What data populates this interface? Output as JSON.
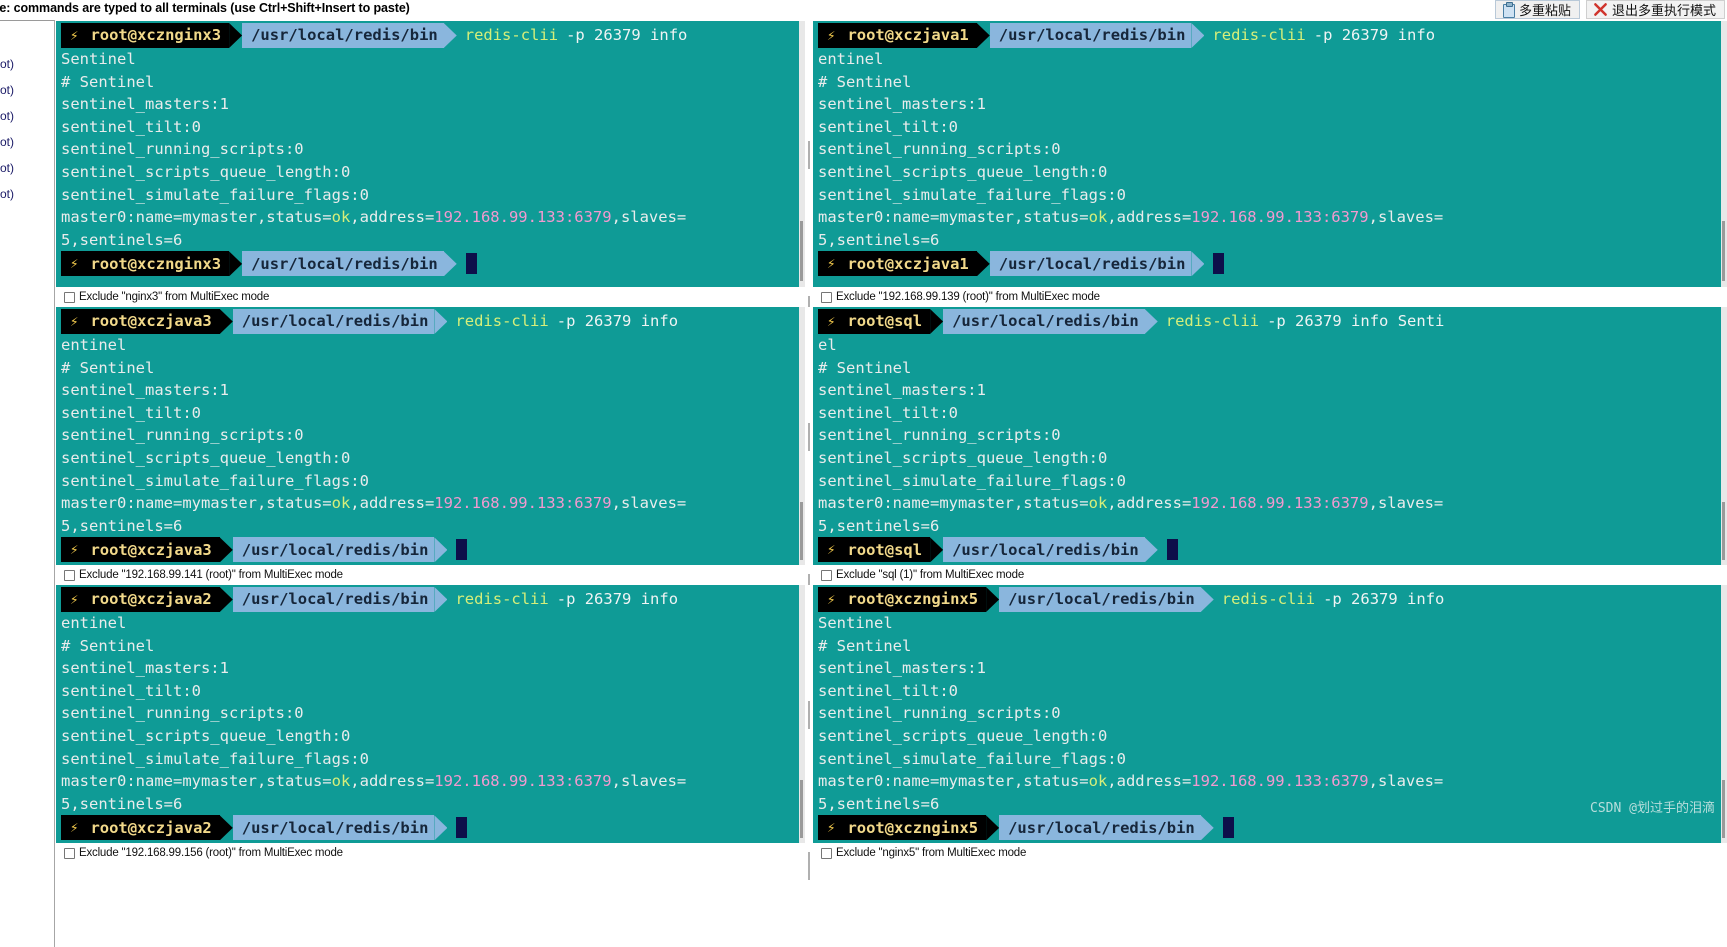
{
  "topbar": {
    "note": "le: commands are typed to all terminals (use Ctrl+Shift+Insert to paste)",
    "multi_paste_label": "多重粘贴",
    "exit_multiexec_label": "退出多重执行模式",
    "clipboard_icon": "clipboard-icon",
    "close_icon": "red-x-icon"
  },
  "sidebar": {
    "items": [
      {
        "label": "ot)"
      },
      {
        "label": "ot)"
      },
      {
        "label": "ot)"
      },
      {
        "label": "ot)"
      },
      {
        "label": "ot)"
      },
      {
        "label": "ot)"
      }
    ]
  },
  "colors": {
    "terminal_bg": "#0f9b96",
    "prompt_host_bg": "#000000",
    "prompt_host_fg": "#f2d98a",
    "prompt_path_bg": "#8ab6dd",
    "prompt_path_fg": "#16263a",
    "command_fg": "#d6ef7a",
    "address_fg": "#f39ad0",
    "cursor": "#0d0f4a",
    "accent_blue": "#4a7fa5",
    "accent_red": "#d0342c"
  },
  "prompt": {
    "bolt_glyph": "⚡",
    "path": "/usr/local/redis/bin"
  },
  "common_output": {
    "l1": "# Sentinel",
    "l2": "sentinel_masters:1",
    "l3": "sentinel_tilt:0",
    "l4": "sentinel_running_scripts:0",
    "l5": "sentinel_scripts_queue_length:0",
    "l6": "sentinel_simulate_failure_flags:0",
    "m_pre": "master0:name=mymaster,status=",
    "m_ok": "ok",
    "m_mid": ",address=",
    "m_addr": "192.168.99.133:6379",
    "m_post": ",slaves=",
    "m_wrap": "5,sentinels=6"
  },
  "terminals": [
    {
      "id": "nginx3",
      "host": "root@xcznginx3",
      "path": "/usr/local/redis/bin",
      "cmd": "redis-clii",
      "args": "-p 26379 info",
      "wrap_head": "Sentinel",
      "exclude_label": "Exclude \"nginx3\" from MultiExec mode"
    },
    {
      "id": "java1",
      "host": "root@xczjava1",
      "path": "/usr/local/redis/bin",
      "cmd": "redis-clii",
      "args": "-p 26379 info",
      "wrap_head": "entinel",
      "exclude_label": "Exclude \"192.168.99.139 (root)\" from MultiExec mode"
    },
    {
      "id": "java3",
      "host": "root@xczjava3",
      "path": "/usr/local/redis/bin",
      "cmd": "redis-clii",
      "args": "-p 26379 info",
      "wrap_head": "entinel",
      "exclude_label": "Exclude \"192.168.99.141 (root)\" from MultiExec mode"
    },
    {
      "id": "sql",
      "host": "root@sql",
      "path": "/usr/local/redis/bin",
      "cmd": "redis-clii",
      "args": "-p 26379 info Senti",
      "wrap_head": "el",
      "exclude_label": "Exclude \"sql (1)\" from MultiExec mode"
    },
    {
      "id": "java2",
      "host": "root@xczjava2",
      "path": "/usr/local/redis/bin",
      "cmd": "redis-clii",
      "args": "-p 26379 info",
      "wrap_head": "entinel",
      "exclude_label": "Exclude \"192.168.99.156 (root)\" from MultiExec mode"
    },
    {
      "id": "nginx5",
      "host": "root@xcznginx5",
      "path": "/usr/local/redis/bin",
      "cmd": "redis-clii",
      "args": "-p 26379 info",
      "wrap_head": "Sentinel",
      "exclude_label": "Exclude \"nginx5\" from MultiExec mode"
    }
  ],
  "watermark": "CSDN @划过手的泪滴"
}
